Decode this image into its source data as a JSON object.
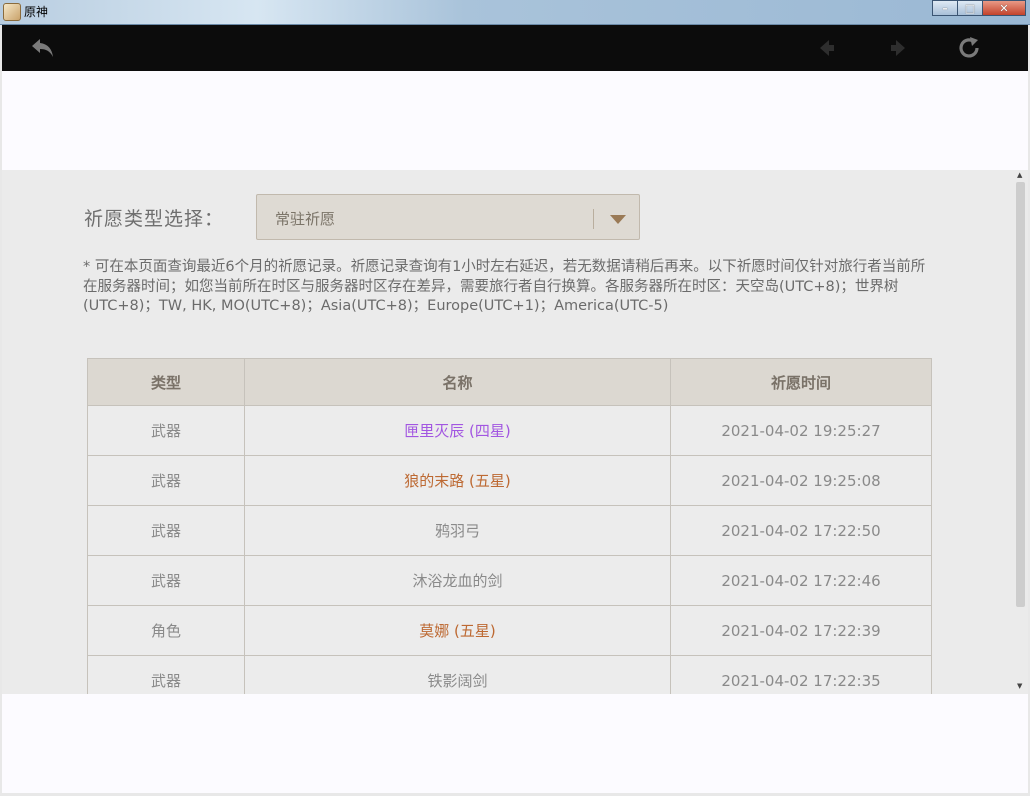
{
  "window": {
    "title": "原神"
  },
  "colors": {
    "four_star": "#a256e1",
    "five_star": "#bd6932",
    "three_star": "#8a8a8a"
  },
  "toolbar": {
    "back_icon": "back-arrow-icon",
    "prev_icon": "nav-left-icon",
    "next_icon": "nav-right-icon",
    "refresh_icon": "refresh-icon"
  },
  "filter": {
    "label": "祈愿类型选择：",
    "selected": "常驻祈愿"
  },
  "notice": "* 可在本页面查询最近6个月的祈愿记录。祈愿记录查询有1小时左右延迟，若无数据请稍后再来。以下祈愿时间仅针对旅行者当前所在服务器时间；如您当前所在时区与服务器时区存在差异，需要旅行者自行换算。各服务器所在时区：天空岛(UTC+8)；世界树(UTC+8)；TW, HK, MO(UTC+8)；Asia(UTC+8)；Europe(UTC+1)；America(UTC-5)",
  "table": {
    "headers": [
      "类型",
      "名称",
      "祈愿时间"
    ],
    "rows": [
      {
        "type": "武器",
        "name": "匣里灭辰 (四星)",
        "time": "2021-04-02 19:25:27",
        "rarity": 4
      },
      {
        "type": "武器",
        "name": "狼的末路 (五星)",
        "time": "2021-04-02 19:25:08",
        "rarity": 5
      },
      {
        "type": "武器",
        "name": "鸦羽弓",
        "time": "2021-04-02 17:22:50",
        "rarity": 3
      },
      {
        "type": "武器",
        "name": "沐浴龙血的剑",
        "time": "2021-04-02 17:22:46",
        "rarity": 3
      },
      {
        "type": "角色",
        "name": "莫娜 (五星)",
        "time": "2021-04-02 17:22:39",
        "rarity": 5
      },
      {
        "type": "武器",
        "name": "铁影阔剑",
        "time": "2021-04-02 17:22:35",
        "rarity": 3
      }
    ]
  }
}
